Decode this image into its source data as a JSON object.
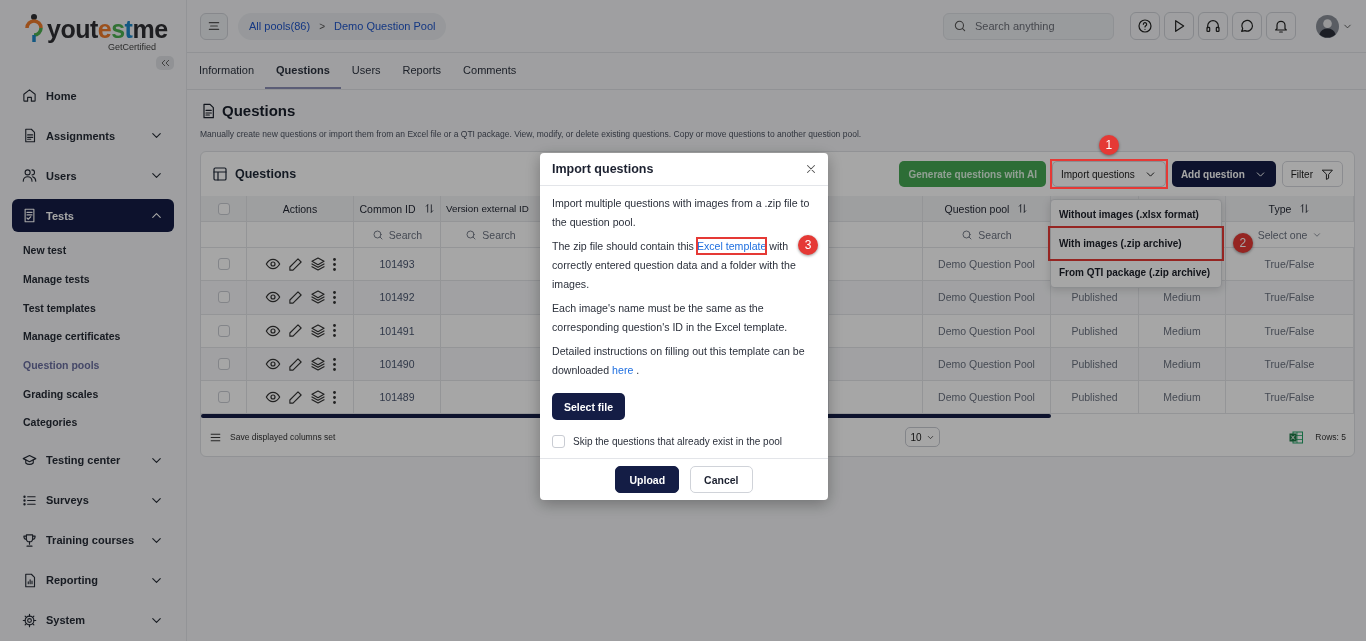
{
  "logo": {
    "text": "youtestme",
    "tagline": "GetCertified"
  },
  "sidebar": {
    "items": [
      {
        "label": "Home",
        "selected": false
      },
      {
        "label": "Assignments",
        "selected": false,
        "expanded": false
      },
      {
        "label": "Users",
        "selected": false,
        "expanded": false
      },
      {
        "label": "Tests",
        "selected": true,
        "expanded": true,
        "children": [
          {
            "label": "New test",
            "selected": false
          },
          {
            "label": "Manage tests",
            "selected": false
          },
          {
            "label": "Test templates",
            "selected": false
          },
          {
            "label": "Manage certificates",
            "selected": false
          },
          {
            "label": "Question pools",
            "selected": true
          },
          {
            "label": "Grading scales",
            "selected": false
          },
          {
            "label": "Categories",
            "selected": false
          }
        ]
      },
      {
        "label": "Testing center",
        "selected": false,
        "expanded": false
      },
      {
        "label": "Surveys",
        "selected": false,
        "expanded": false
      },
      {
        "label": "Training courses",
        "selected": false,
        "expanded": false
      },
      {
        "label": "Reporting",
        "selected": false,
        "expanded": false
      },
      {
        "label": "System",
        "selected": false,
        "expanded": false
      }
    ]
  },
  "topbar": {
    "breadcrumb": [
      {
        "label": "All pools(86)"
      },
      {
        "label": "Demo Question Pool"
      }
    ],
    "separator": ">",
    "search": {
      "placeholder": "Search anything"
    }
  },
  "tabs": [
    {
      "label": "Information",
      "selected": false
    },
    {
      "label": "Questions",
      "selected": true
    },
    {
      "label": "Users",
      "selected": false
    },
    {
      "label": "Reports",
      "selected": false
    },
    {
      "label": "Comments",
      "selected": false
    }
  ],
  "page": {
    "title": "Questions",
    "description": "Manually create new questions or import them from an Excel file or a QTI package. View, modify, or delete existing questions. Copy or move questions to another question pool."
  },
  "card": {
    "title": "Questions",
    "buttons": [
      {
        "label": "Generate questions with AI",
        "kind": "success"
      },
      {
        "label": "Import questions",
        "kind": "secondary",
        "caret": true,
        "annotation": "1"
      },
      {
        "label": "Add question",
        "kind": "primary",
        "caret": true
      },
      {
        "label": "Filter",
        "kind": "filter"
      }
    ]
  },
  "import_menu": {
    "items": [
      {
        "label": "Without images (.xlsx format)"
      },
      {
        "label": "With images (.zip archive)",
        "annotation": "2"
      },
      {
        "label": "From QTI package (.zip archive)"
      }
    ]
  },
  "table": {
    "select_all": {
      "checked": false
    },
    "columns": [
      {
        "label": "Actions"
      },
      {
        "label": "Common ID",
        "sortable": true,
        "filter": {
          "kind": "search",
          "placeholder": "Search"
        }
      },
      {
        "label": "Version external ID",
        "filter": {
          "kind": "search",
          "placeholder": "Search"
        }
      },
      {},
      {
        "label": "Question pool",
        "sortable": true,
        "filter": {
          "kind": "search",
          "placeholder": "Search"
        }
      },
      {},
      {},
      {
        "label": "Type",
        "sortable": true,
        "filter": {
          "kind": "select",
          "placeholder": "Select one"
        }
      }
    ],
    "rows": [
      {
        "checked": false,
        "common_id": "101493",
        "question_pool": "Demo Question Pool",
        "type": "True/False"
      },
      {
        "checked": false,
        "common_id": "101492",
        "question_pool": "Demo Question Pool",
        "status": "Published",
        "difficulty": "Medium",
        "type": "True/False"
      },
      {
        "checked": false,
        "common_id": "101491",
        "question_pool": "Demo Question Pool",
        "status": "Published",
        "difficulty": "Medium",
        "type": "True/False"
      },
      {
        "checked": false,
        "common_id": "101490",
        "question_pool": "Demo Question Pool",
        "status": "Published",
        "difficulty": "Medium",
        "type": "True/False"
      },
      {
        "checked": false,
        "common_id": "101489",
        "question_pool": "Demo Question Pool",
        "status": "Published",
        "difficulty": "Medium",
        "type": "True/False"
      }
    ],
    "footer": {
      "save_label": "Save displayed columns set",
      "page_size": "10",
      "rows_label": "Rows: 5"
    }
  },
  "modal": {
    "title": "Import questions",
    "paragraphs": [
      {
        "parts": [
          {
            "kind": "text",
            "text": "Import multiple questions with images from a .zip file to the question pool."
          }
        ]
      },
      {
        "parts": [
          {
            "kind": "text",
            "text": "The zip file should contain this "
          },
          {
            "kind": "link",
            "text": "Excel template",
            "annotation": "3"
          },
          {
            "kind": "text",
            "text": " with"
          },
          {
            "kind": "text",
            "text": " correctly entered question data and a folder with the images."
          }
        ]
      },
      {
        "parts": [
          {
            "kind": "text",
            "text": "Each image's name must be the same as the corresponding question's ID in the Excel template."
          }
        ]
      },
      {
        "parts": [
          {
            "kind": "text",
            "text": "Detailed instructions on filling out this template can be downloaded "
          },
          {
            "kind": "link",
            "text": "here"
          },
          {
            "kind": "text",
            "text": " ."
          }
        ]
      }
    ],
    "select_button": "Select file",
    "skip": {
      "label": "Skip the questions that already exist in the pool",
      "checked": false
    },
    "buttons": [
      {
        "label": "Upload",
        "kind": "primary"
      },
      {
        "label": "Cancel",
        "kind": "outline"
      }
    ]
  }
}
